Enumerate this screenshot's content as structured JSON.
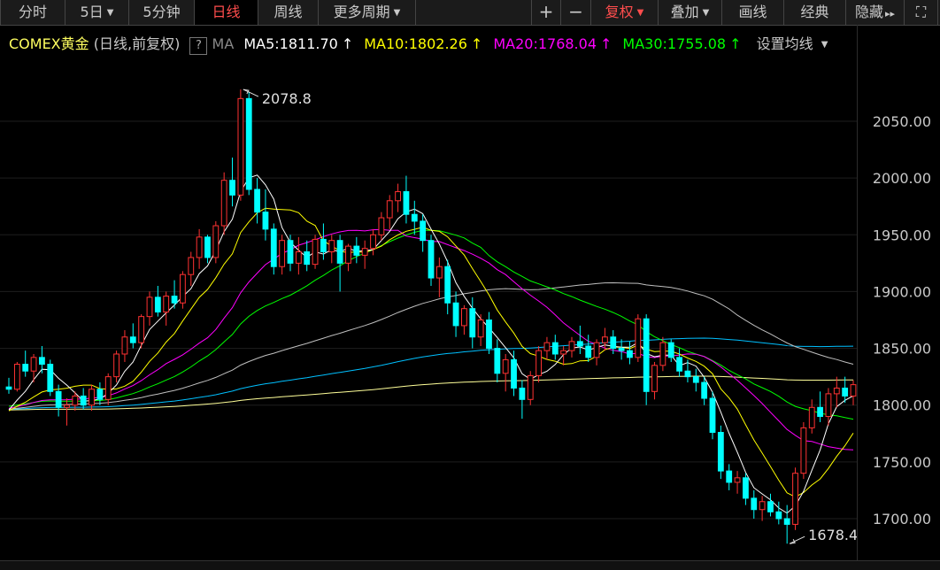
{
  "toolbar": {
    "left": [
      {
        "label": "分时",
        "name": "tab-intraday"
      },
      {
        "label": "5日",
        "name": "tab-5day",
        "dropdown": true
      },
      {
        "label": "5分钟",
        "name": "tab-5min"
      },
      {
        "label": "日线",
        "name": "tab-daily",
        "active": true
      },
      {
        "label": "周线",
        "name": "tab-weekly"
      },
      {
        "label": "更多周期",
        "name": "tab-more-periods",
        "dropdown": true
      }
    ],
    "right": [
      {
        "label": "+",
        "name": "zoom-in-button"
      },
      {
        "label": "−",
        "name": "zoom-out-button"
      },
      {
        "label": "复权",
        "name": "adjust-button",
        "dropdown": true,
        "red": true
      },
      {
        "label": "叠加",
        "name": "overlay-button",
        "dropdown": true
      },
      {
        "label": "画线",
        "name": "draw-line-button"
      },
      {
        "label": "经典",
        "name": "classic-button"
      },
      {
        "label": "隐藏",
        "name": "hide-button",
        "arrow": "▸▸"
      },
      {
        "label": "⛶",
        "name": "fullscreen-icon"
      }
    ]
  },
  "legend": {
    "instrument": "COMEX黄金",
    "mode": "(日线,前复权)",
    "help": "?",
    "ma_label": "MA",
    "ma": [
      {
        "label": "MA5:1811.70",
        "arrow": "↑",
        "color": "#ffffff"
      },
      {
        "label": "MA10:1802.26",
        "arrow": "↑",
        "color": "#ffff00"
      },
      {
        "label": "MA20:1768.04",
        "arrow": "↑",
        "color": "#ff00ff"
      },
      {
        "label": "MA30:1755.08",
        "arrow": "↑",
        "color": "#00ff00"
      }
    ],
    "settings": "设置均线"
  },
  "chart_data": {
    "type": "candlestick",
    "ylim": [
      1665,
      2085
    ],
    "yticks": [
      "2050.00",
      "2000.00",
      "1950.00",
      "1900.00",
      "1850.00",
      "1800.00",
      "1750.00",
      "1700.00"
    ],
    "annotations": {
      "high": "2078.8",
      "low": "1678.4"
    },
    "colors": {
      "up": "#ff3232",
      "down": "#00ffff",
      "ma5": "#ffffff",
      "ma10": "#ffff00",
      "ma20": "#ff00ff",
      "ma30": "#00ff00",
      "ma60": "#bfbfbf",
      "ma120": "#00c0ff",
      "ma250": "#ffff99"
    },
    "ohlc": [
      [
        1816,
        1824,
        1810,
        1814
      ],
      [
        1814,
        1838,
        1812,
        1836
      ],
      [
        1836,
        1848,
        1825,
        1830
      ],
      [
        1830,
        1845,
        1820,
        1842
      ],
      [
        1842,
        1852,
        1828,
        1836
      ],
      [
        1836,
        1840,
        1808,
        1812
      ],
      [
        1812,
        1818,
        1790,
        1798
      ],
      [
        1798,
        1806,
        1782,
        1800
      ],
      [
        1800,
        1812,
        1795,
        1808
      ],
      [
        1808,
        1815,
        1796,
        1800
      ],
      [
        1800,
        1818,
        1795,
        1814
      ],
      [
        1814,
        1820,
        1800,
        1805
      ],
      [
        1805,
        1828,
        1800,
        1825
      ],
      [
        1825,
        1848,
        1820,
        1845
      ],
      [
        1845,
        1866,
        1838,
        1860
      ],
      [
        1860,
        1872,
        1850,
        1855
      ],
      [
        1855,
        1880,
        1850,
        1878
      ],
      [
        1878,
        1900,
        1870,
        1895
      ],
      [
        1895,
        1905,
        1878,
        1882
      ],
      [
        1882,
        1900,
        1870,
        1896
      ],
      [
        1896,
        1910,
        1885,
        1890
      ],
      [
        1890,
        1918,
        1885,
        1915
      ],
      [
        1915,
        1935,
        1905,
        1930
      ],
      [
        1930,
        1955,
        1920,
        1948
      ],
      [
        1948,
        1950,
        1925,
        1930
      ],
      [
        1930,
        1962,
        1925,
        1958
      ],
      [
        1958,
        2005,
        1950,
        1998
      ],
      [
        1998,
        2018,
        1975,
        1985
      ],
      [
        1985,
        2078,
        1980,
        2070
      ],
      [
        2070,
        2076,
        1985,
        1990
      ],
      [
        1990,
        2000,
        1960,
        1970
      ],
      [
        1970,
        1990,
        1945,
        1955
      ],
      [
        1955,
        1960,
        1915,
        1922
      ],
      [
        1922,
        1950,
        1915,
        1945
      ],
      [
        1945,
        1950,
        1918,
        1925
      ],
      [
        1925,
        1948,
        1915,
        1935
      ],
      [
        1935,
        1945,
        1918,
        1924
      ],
      [
        1924,
        1950,
        1920,
        1946
      ],
      [
        1946,
        1960,
        1928,
        1935
      ],
      [
        1935,
        1950,
        1925,
        1945
      ],
      [
        1945,
        1950,
        1900,
        1925
      ],
      [
        1925,
        1942,
        1918,
        1940
      ],
      [
        1940,
        1948,
        1925,
        1932
      ],
      [
        1932,
        1945,
        1920,
        1938
      ],
      [
        1938,
        1955,
        1932,
        1950
      ],
      [
        1950,
        1970,
        1945,
        1965
      ],
      [
        1965,
        1985,
        1955,
        1980
      ],
      [
        1980,
        1995,
        1970,
        1988
      ],
      [
        1988,
        2002,
        1960,
        1968
      ],
      [
        1968,
        1980,
        1950,
        1962
      ],
      [
        1962,
        1968,
        1935,
        1945
      ],
      [
        1945,
        1950,
        1905,
        1912
      ],
      [
        1912,
        1930,
        1895,
        1922
      ],
      [
        1922,
        1928,
        1880,
        1890
      ],
      [
        1890,
        1900,
        1860,
        1870
      ],
      [
        1870,
        1888,
        1862,
        1885
      ],
      [
        1885,
        1895,
        1850,
        1860
      ],
      [
        1860,
        1880,
        1852,
        1875
      ],
      [
        1875,
        1882,
        1845,
        1850
      ],
      [
        1850,
        1858,
        1820,
        1828
      ],
      [
        1828,
        1845,
        1812,
        1840
      ],
      [
        1840,
        1848,
        1808,
        1815
      ],
      [
        1815,
        1822,
        1788,
        1805
      ],
      [
        1805,
        1830,
        1800,
        1826
      ],
      [
        1826,
        1852,
        1820,
        1848
      ],
      [
        1848,
        1860,
        1840,
        1855
      ],
      [
        1855,
        1862,
        1840,
        1845
      ],
      [
        1845,
        1852,
        1835,
        1848
      ],
      [
        1848,
        1860,
        1842,
        1856
      ],
      [
        1856,
        1870,
        1845,
        1852
      ],
      [
        1852,
        1862,
        1838,
        1842
      ],
      [
        1842,
        1858,
        1835,
        1855
      ],
      [
        1855,
        1868,
        1848,
        1860
      ],
      [
        1860,
        1866,
        1845,
        1850
      ],
      [
        1850,
        1858,
        1840,
        1848
      ],
      [
        1848,
        1856,
        1836,
        1842
      ],
      [
        1842,
        1880,
        1838,
        1876
      ],
      [
        1876,
        1880,
        1800,
        1812
      ],
      [
        1812,
        1838,
        1805,
        1835
      ],
      [
        1835,
        1860,
        1830,
        1855
      ],
      [
        1855,
        1858,
        1838,
        1842
      ],
      [
        1842,
        1850,
        1825,
        1830
      ],
      [
        1830,
        1840,
        1820,
        1825
      ],
      [
        1825,
        1832,
        1812,
        1820
      ],
      [
        1820,
        1825,
        1800,
        1806
      ],
      [
        1806,
        1812,
        1770,
        1776
      ],
      [
        1776,
        1782,
        1735,
        1742
      ],
      [
        1742,
        1748,
        1725,
        1732
      ],
      [
        1732,
        1742,
        1722,
        1736
      ],
      [
        1736,
        1740,
        1712,
        1718
      ],
      [
        1718,
        1725,
        1700,
        1708
      ],
      [
        1708,
        1720,
        1698,
        1715
      ],
      [
        1715,
        1722,
        1702,
        1706
      ],
      [
        1706,
        1715,
        1695,
        1700
      ],
      [
        1700,
        1712,
        1678,
        1695
      ],
      [
        1695,
        1745,
        1690,
        1740
      ],
      [
        1740,
        1785,
        1735,
        1780
      ],
      [
        1780,
        1805,
        1775,
        1798
      ],
      [
        1798,
        1812,
        1785,
        1790
      ],
      [
        1790,
        1815,
        1782,
        1810
      ],
      [
        1810,
        1825,
        1798,
        1815
      ],
      [
        1815,
        1825,
        1802,
        1808
      ],
      [
        1808,
        1822,
        1800,
        1818
      ]
    ]
  }
}
